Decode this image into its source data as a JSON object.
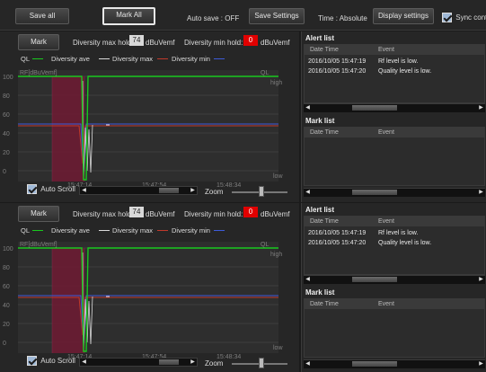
{
  "toolbar": {
    "save_all": "Save all",
    "mark_all": "Mark All",
    "auto_save": "Auto save : OFF",
    "save_settings": "Save Settings",
    "time": "Time : Absolute",
    "display_settings": "Display settings",
    "sync": "Sync cont"
  },
  "panels": [
    {
      "mark": "Mark",
      "div_max_hold_label": "Diversity max hold:",
      "div_max_hold_value": "74",
      "div_max_unit": "dBuVemf",
      "div_min_hold_label": "Diversity min hold:",
      "div_min_hold_value": "0",
      "div_min_unit": "dBuVemf",
      "legend": {
        "ql": "QL",
        "ave": "Diversity ave",
        "max": "Diversity max",
        "min": "Diversity min"
      },
      "chart": {
        "rf_label": "RF[dBuVemf]",
        "ql_label": "QL",
        "high": "high",
        "low": "low",
        "yticks": [
          "100",
          "80",
          "60",
          "40",
          "20",
          "0"
        ],
        "xticks": [
          "15:47:14",
          "15:47:54",
          "15:48:34"
        ]
      },
      "auto_scroll": "Auto Scroll",
      "zoom": "Zoom",
      "alert_title": "Alert list",
      "alert_cols": [
        "Date Time",
        "Event"
      ],
      "alerts": [
        {
          "time": "2016/10/05  15:47:19",
          "event": "Rf level is low."
        },
        {
          "time": "2016/10/05  15:47:20",
          "event": "Quality level is low."
        }
      ],
      "mark_title": "Mark list",
      "mark_cols": [
        "Date Time",
        "Event"
      ]
    },
    {
      "mark": "Mark",
      "div_max_hold_label": "Diversity max hold:",
      "div_max_hold_value": "74",
      "div_max_unit": "dBuVemf",
      "div_min_hold_label": "Diversity min hold:",
      "div_min_hold_value": "0",
      "div_min_unit": "dBuVemf",
      "legend": {
        "ql": "QL",
        "ave": "Diversity ave",
        "max": "Diversity max",
        "min": "Diversity min"
      },
      "chart": {
        "rf_label": "RF[dBuVemf]",
        "ql_label": "QL",
        "high": "high",
        "low": "low",
        "yticks": [
          "100",
          "80",
          "60",
          "40",
          "20",
          "0"
        ],
        "xticks": [
          "15:47:14",
          "15:47:54",
          "15:48:34"
        ]
      },
      "auto_scroll": "Auto Scroll",
      "zoom": "Zoom",
      "alert_title": "Alert list",
      "alert_cols": [
        "Date Time",
        "Event"
      ],
      "alerts": [
        {
          "time": "2016/10/05  15:47:19",
          "event": "Rf level is low."
        },
        {
          "time": "2016/10/05  15:47:20",
          "event": "Quality level is low."
        }
      ],
      "mark_title": "Mark list",
      "mark_cols": [
        "Date Time",
        "Event"
      ]
    }
  ],
  "colors": {
    "ql": "#19c81e",
    "ave": "#d9d9d9",
    "max": "#c0392b",
    "min": "#3d5bd9",
    "mark_region": "#6e1a33"
  }
}
